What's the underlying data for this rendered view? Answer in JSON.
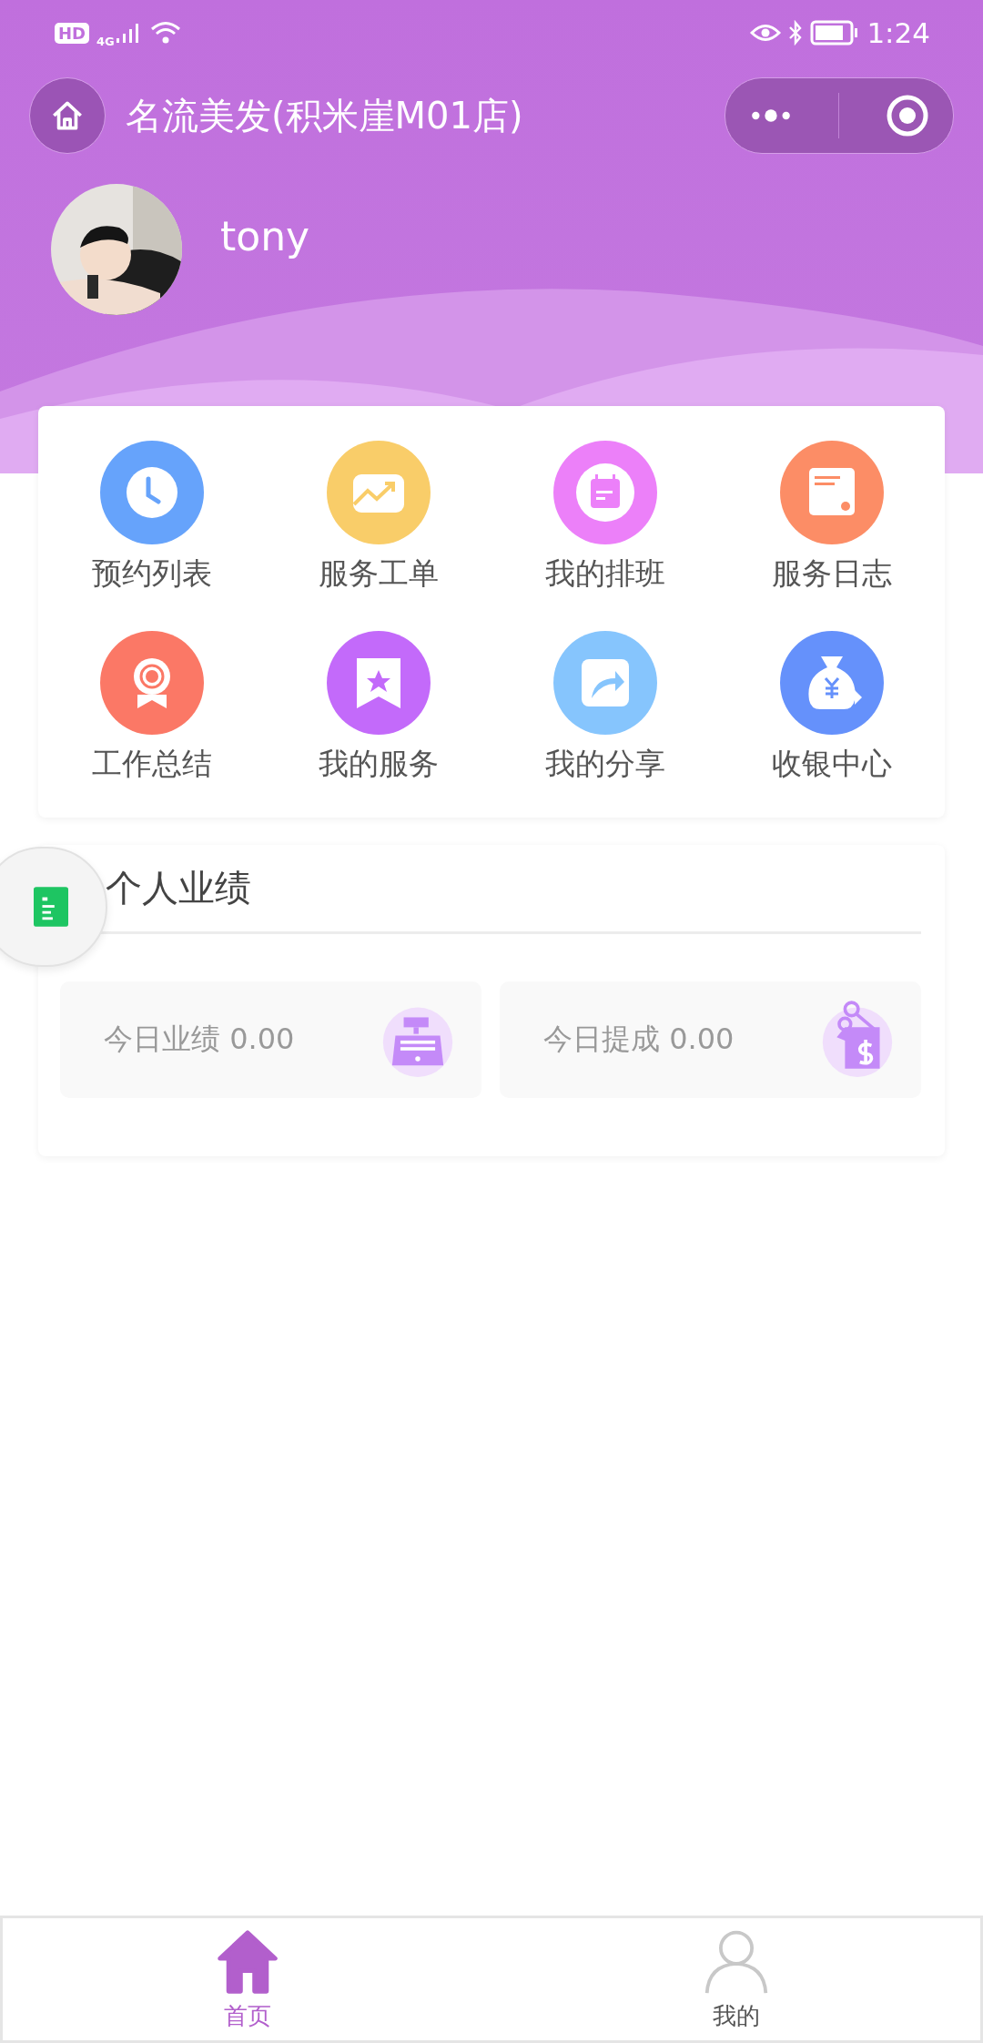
{
  "status_bar": {
    "hd": "HD",
    "network": "4G",
    "time": "1:24"
  },
  "nav": {
    "title": "名流美发(积米崖M01店)"
  },
  "profile": {
    "name": "tony"
  },
  "menu": [
    {
      "label": "预约列表",
      "color": "#66a3fb"
    },
    {
      "label": "服务工单",
      "color": "#f9cd69"
    },
    {
      "label": "我的排班",
      "color": "#ec80f9"
    },
    {
      "label": "服务日志",
      "color": "#fc8d66"
    },
    {
      "label": "工作总结",
      "color": "#fb7866"
    },
    {
      "label": "我的服务",
      "color": "#c36afa"
    },
    {
      "label": "我的分享",
      "color": "#86c5fd"
    },
    {
      "label": "收银中心",
      "color": "#6591fb"
    }
  ],
  "performance": {
    "title": "个人业绩",
    "stats": [
      {
        "label": "今日业绩 0.00"
      },
      {
        "label": "今日提成 0.00"
      }
    ]
  },
  "tabs": [
    {
      "label": "首页",
      "selected": true
    },
    {
      "label": "我的",
      "selected": false
    }
  ]
}
